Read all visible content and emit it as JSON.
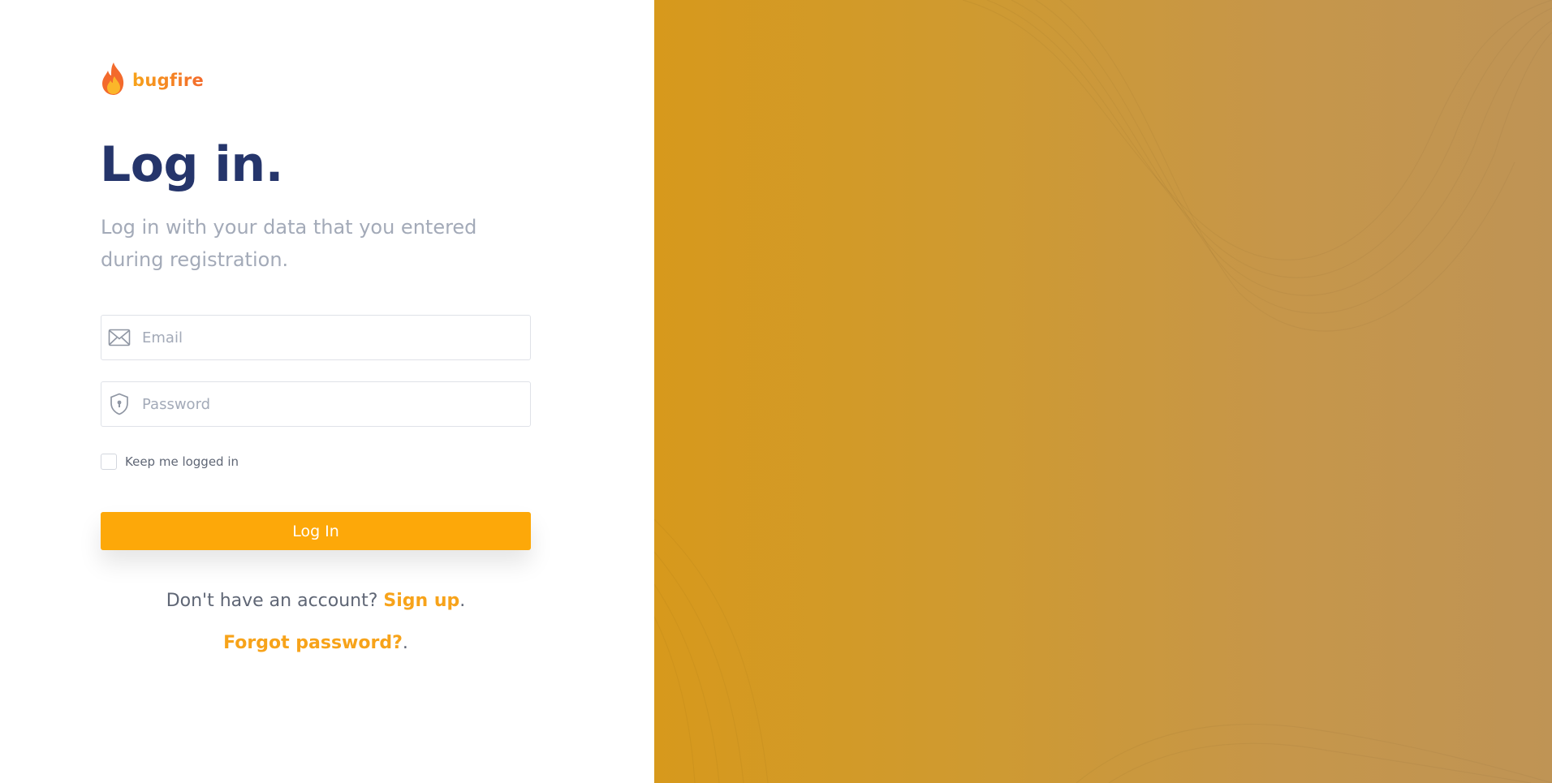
{
  "brand": {
    "name": "bugfire",
    "logo_icon": "flame-icon"
  },
  "heading": {
    "title": "Log in.",
    "subtitle": "Log in with your data that you entered during registration."
  },
  "form": {
    "email": {
      "placeholder": "Email",
      "value": "",
      "icon": "envelope-icon"
    },
    "password": {
      "placeholder": "Password",
      "value": "",
      "icon": "shield-lock-icon"
    },
    "remember": {
      "label": "Keep me logged in",
      "checked": false
    },
    "submit_label": "Log In"
  },
  "footer": {
    "signup_prompt": "Don't have an account?",
    "signup_link": "Sign up",
    "signup_suffix": ".",
    "forgot_link": "Forgot password?",
    "forgot_suffix": "."
  },
  "colors": {
    "primary": "#fda809",
    "heading": "#25356b",
    "muted_text": "#a3aab8",
    "link": "#f7a31a",
    "panel_start": "#d7991c",
    "panel_end": "#bf9455"
  }
}
